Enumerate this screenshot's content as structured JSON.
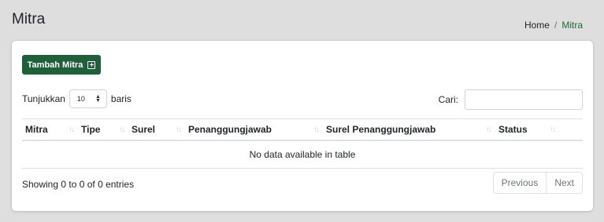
{
  "header": {
    "title": "Mitra",
    "breadcrumb": {
      "home": "Home",
      "separator": "/",
      "current": "Mitra"
    }
  },
  "toolbar": {
    "add_label": "Tambah Mitra",
    "add_icon": "plus-square-icon"
  },
  "length_menu": {
    "prefix": "Tunjukkan",
    "value": "10",
    "suffix": "baris"
  },
  "search": {
    "label": "Cari:",
    "value": "",
    "placeholder": ""
  },
  "table": {
    "columns": [
      "Mitra",
      "Tipe",
      "Surel",
      "Penanggungjawab",
      "Surel Penanggungjawab",
      "Status"
    ],
    "empty_message": "No data available in table"
  },
  "footer": {
    "info": "Showing 0 to 0 of 0 entries",
    "previous_label": "Previous",
    "next_label": "Next"
  },
  "colors": {
    "accent": "#1f5f3a",
    "breadcrumb_active": "#1d6b3a",
    "background": "#dddedd"
  }
}
